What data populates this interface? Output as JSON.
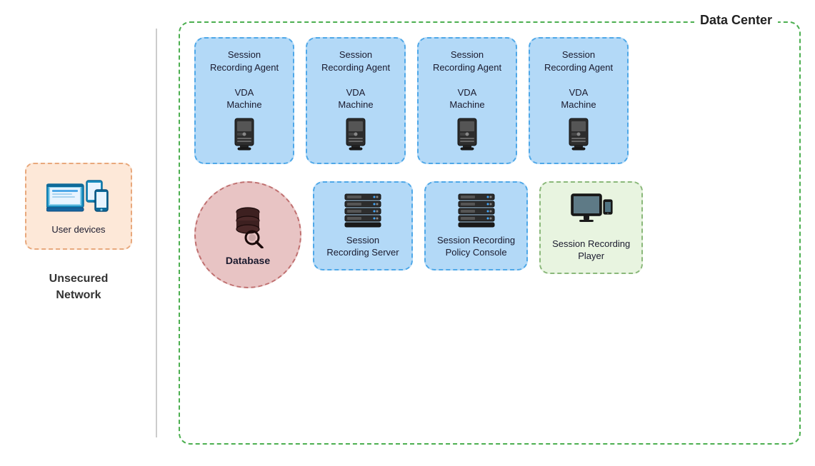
{
  "left": {
    "unsecured_label": "Unsecured\nNetwork",
    "user_devices_label": "User devices"
  },
  "right": {
    "data_center_title": "Data Center",
    "agents": [
      {
        "label": "Session\nRecording Agent\n\nVDA\nMachine"
      },
      {
        "label": "Session\nRecording Agent\n\nVDA\nMachine"
      },
      {
        "label": "Session\nRecording Agent\n\nVDA\nMachine"
      },
      {
        "label": "Session\nRecording Agent\n\nVDA\nMachine"
      }
    ],
    "database_label": "Database",
    "session_recording_server_label": "Session\nRecording Server",
    "policy_console_label": "Session Recording\nPolicy Console",
    "player_label": "Session Recording\nPlayer"
  }
}
